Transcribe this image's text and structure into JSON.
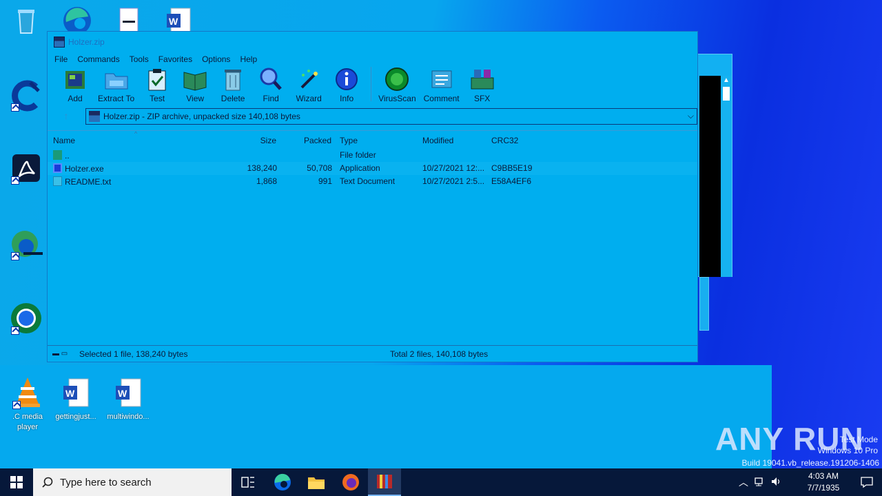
{
  "desktop": {
    "icons_top": [
      {
        "id": "recycle-bin",
        "label": ""
      },
      {
        "id": "edge",
        "label": ""
      },
      {
        "id": "file",
        "label": ""
      },
      {
        "id": "word",
        "label": ""
      }
    ],
    "icons_left": [
      {
        "id": "ccleaner",
        "label": ""
      },
      {
        "id": "acrobat",
        "label": ""
      },
      {
        "id": "edge-app",
        "label": ""
      },
      {
        "id": "chrome",
        "label": ""
      }
    ],
    "icons_bottom": [
      {
        "id": "vlc",
        "label": ".C media player"
      },
      {
        "id": "doc1",
        "label": "gettingjust..."
      },
      {
        "id": "doc2",
        "label": "multiwindo..."
      }
    ]
  },
  "window": {
    "title": "Holzer.zip",
    "menu": [
      "File",
      "Commands",
      "Tools",
      "Favorites",
      "Options",
      "Help"
    ],
    "toolbar": [
      {
        "label": "Add",
        "icon": "add-icon"
      },
      {
        "label": "Extract To",
        "icon": "extract-icon"
      },
      {
        "label": "Test",
        "icon": "test-icon"
      },
      {
        "label": "View",
        "icon": "view-icon"
      },
      {
        "label": "Delete",
        "icon": "delete-icon"
      },
      {
        "label": "Find",
        "icon": "find-icon"
      },
      {
        "label": "Wizard",
        "icon": "wizard-icon"
      },
      {
        "label": "Info",
        "icon": "info-icon"
      },
      {
        "label": "VirusScan",
        "icon": "virusscan-icon"
      },
      {
        "label": "Comment",
        "icon": "comment-icon"
      },
      {
        "label": "SFX",
        "icon": "sfx-icon"
      }
    ],
    "address": "Holzer.zip - ZIP archive, unpacked size 140,108 bytes",
    "columns": {
      "name": "Name",
      "size": "Size",
      "packed": "Packed",
      "type": "Type",
      "modified": "Modified",
      "crc": "CRC32"
    },
    "files": [
      {
        "name": "..",
        "size": "",
        "packed": "",
        "type": "File folder",
        "modified": "",
        "crc": ""
      },
      {
        "name": "Holzer.exe",
        "size": "138,240",
        "packed": "50,708",
        "type": "Application",
        "modified": "10/27/2021 12:...",
        "crc": "C9BB5E19"
      },
      {
        "name": "README.txt",
        "size": "1,868",
        "packed": "991",
        "type": "Text Document",
        "modified": "10/27/2021 2:5...",
        "crc": "E58A4EF6"
      }
    ],
    "status_left": "Selected 1 file, 138,240 bytes",
    "status_right": "Total 2 files, 140,108 bytes"
  },
  "taskbar": {
    "search_placeholder": "Type here to search",
    "time": "4:03 AM",
    "date": "7/7/1935"
  },
  "watermark": {
    "logo": "ANY RUN",
    "line1": "Test Mode",
    "line2": "Windows 10 Pro",
    "line3": "Build 19041.vb_release.191206-1406"
  }
}
